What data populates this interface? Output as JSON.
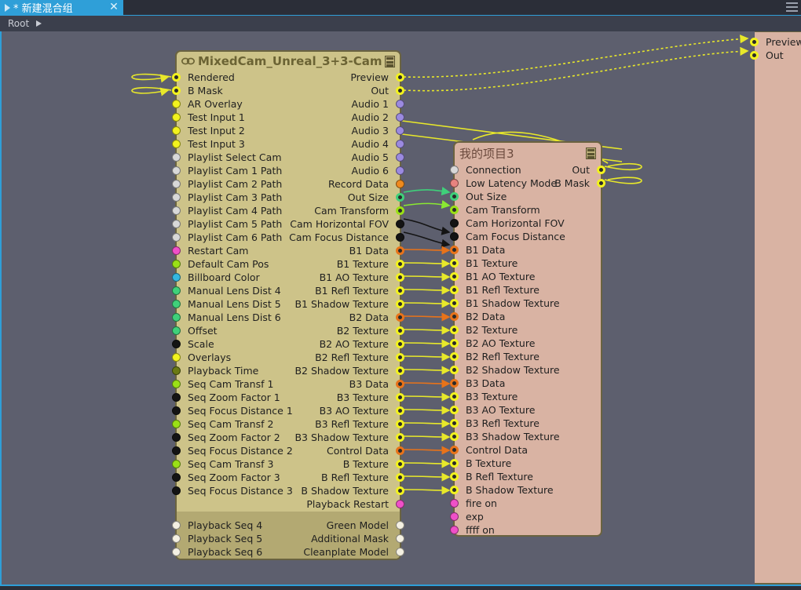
{
  "window": {
    "tab_label": "* 新建混合组",
    "tab_close": "✕",
    "breadcrumb": "Root",
    "menu_icon": "hamburger-icon"
  },
  "colors": {
    "canvas_bg": "#5d5f6e",
    "node_main_bg": "#cdc389",
    "node_sec_bg": "#d9b3a3",
    "accent": "#2f9fd8",
    "wire_yellow": "#e8e82a",
    "wire_green": "#3fd07a",
    "wire_lightgreen": "#8ae832",
    "wire_black": "#141414",
    "wire_orange": "#e8731a"
  },
  "main_node": {
    "title": "MixedCam_Unreal_3+3-Cam",
    "icon": "link-icon",
    "menu_icon": "burger-icon",
    "inputs": [
      {
        "label": "Rendered",
        "color": "#f2f21e",
        "ring": true
      },
      {
        "label": "B Mask",
        "color": "#f2f21e",
        "ring": true
      },
      {
        "label": "AR Overlay",
        "color": "#f2f21e",
        "ring": false
      },
      {
        "label": "Test Input 1",
        "color": "#f2f21e",
        "ring": false
      },
      {
        "label": "Test Input 2",
        "color": "#f2f21e",
        "ring": false
      },
      {
        "label": "Test Input 3",
        "color": "#f2f21e",
        "ring": false
      },
      {
        "label": "Playlist Select Cam",
        "color": "#d8d8d8",
        "ring": false
      },
      {
        "label": "Playlist Cam 1 Path",
        "color": "#d8d8d8",
        "ring": false
      },
      {
        "label": "Playlist Cam 2 Path",
        "color": "#d8d8d8",
        "ring": false
      },
      {
        "label": "Playlist Cam 3 Path",
        "color": "#d8d8d8",
        "ring": false
      },
      {
        "label": "Playlist Cam 4 Path",
        "color": "#d8d8d8",
        "ring": false
      },
      {
        "label": "Playlist Cam 5 Path",
        "color": "#d8d8d8",
        "ring": false
      },
      {
        "label": "Playlist Cam 6 Path",
        "color": "#d8d8d8",
        "ring": false
      },
      {
        "label": "Restart Cam",
        "color": "#f050c8",
        "ring": false
      },
      {
        "label": "Default Cam Pos",
        "color": "#9ae016",
        "ring": false
      },
      {
        "label": "Billboard Color",
        "color": "#35b8e0",
        "ring": false
      },
      {
        "label": "Manual Lens Dist 4",
        "color": "#3fd07a",
        "ring": false
      },
      {
        "label": "Manual Lens Dist 5",
        "color": "#3fd07a",
        "ring": false
      },
      {
        "label": "Manual Lens Dist 6",
        "color": "#3fd07a",
        "ring": false
      },
      {
        "label": "Offset",
        "color": "#3fd07a",
        "ring": false
      },
      {
        "label": "Scale",
        "color": "#141414",
        "ring": false
      },
      {
        "label": "Overlays",
        "color": "#f2f21e",
        "ring": false
      },
      {
        "label": "Playback Time",
        "color": "#6b7a14",
        "ring": false
      },
      {
        "label": "Seq Cam Transf 1",
        "color": "#9ae016",
        "ring": false
      },
      {
        "label": "Seq Zoom Factor 1",
        "color": "#141414",
        "ring": false
      },
      {
        "label": "Seq Focus Distance 1",
        "color": "#141414",
        "ring": false
      },
      {
        "label": "Seq Cam Transf 2",
        "color": "#9ae016",
        "ring": false
      },
      {
        "label": "Seq Zoom Factor 2",
        "color": "#141414",
        "ring": false
      },
      {
        "label": "Seq Focus Distance 2",
        "color": "#141414",
        "ring": false
      },
      {
        "label": "Seq Cam Transf 3",
        "color": "#9ae016",
        "ring": false
      },
      {
        "label": "Seq Zoom Factor 3",
        "color": "#141414",
        "ring": false
      },
      {
        "label": "Seq Focus Distance 3",
        "color": "#141414",
        "ring": false
      }
    ],
    "inputs_footer": [
      {
        "label": "Playback Seq 4",
        "color": "#f4f0e2",
        "ring": false
      },
      {
        "label": "Playback Seq 5",
        "color": "#f4f0e2",
        "ring": false
      },
      {
        "label": "Playback Seq 6",
        "color": "#f4f0e2",
        "ring": false
      }
    ],
    "outputs": [
      {
        "label": "Preview",
        "color": "#f2f21e",
        "ring": true
      },
      {
        "label": "Out",
        "color": "#f2f21e",
        "ring": true
      },
      {
        "label": "Audio 1",
        "color": "#9b8ae0",
        "ring": false
      },
      {
        "label": "Audio 2",
        "color": "#9b8ae0",
        "ring": false
      },
      {
        "label": "Audio 3",
        "color": "#9b8ae0",
        "ring": false
      },
      {
        "label": "Audio 4",
        "color": "#9b8ae0",
        "ring": false
      },
      {
        "label": "Audio 5",
        "color": "#9b8ae0",
        "ring": false
      },
      {
        "label": "Audio 6",
        "color": "#9b8ae0",
        "ring": false
      },
      {
        "label": "Record Data",
        "color": "#f08a1e",
        "ring": false
      },
      {
        "label": "Out Size",
        "color": "#3fd07a",
        "ring": true
      },
      {
        "label": "Cam Transform",
        "color": "#9ae016",
        "ring": true
      },
      {
        "label": "Cam Horizontal FOV",
        "color": "#141414",
        "ring": false
      },
      {
        "label": "Cam Focus Distance",
        "color": "#141414",
        "ring": false
      },
      {
        "label": "B1 Data",
        "color": "#e8731a",
        "ring": true
      },
      {
        "label": "B1 Texture",
        "color": "#f2f21e",
        "ring": true
      },
      {
        "label": "B1 AO Texture",
        "color": "#f2f21e",
        "ring": true
      },
      {
        "label": "B1 Refl Texture",
        "color": "#f2f21e",
        "ring": true
      },
      {
        "label": "B1 Shadow Texture",
        "color": "#f2f21e",
        "ring": true
      },
      {
        "label": "B2 Data",
        "color": "#e8731a",
        "ring": true
      },
      {
        "label": "B2 Texture",
        "color": "#f2f21e",
        "ring": true
      },
      {
        "label": "B2 AO Texture",
        "color": "#f2f21e",
        "ring": true
      },
      {
        "label": "B2 Refl Texture",
        "color": "#f2f21e",
        "ring": true
      },
      {
        "label": "B2 Shadow Texture",
        "color": "#f2f21e",
        "ring": true
      },
      {
        "label": "B3 Data",
        "color": "#e8731a",
        "ring": true
      },
      {
        "label": "B3 Texture",
        "color": "#f2f21e",
        "ring": true
      },
      {
        "label": "B3 AO Texture",
        "color": "#f2f21e",
        "ring": true
      },
      {
        "label": "B3 Refl Texture",
        "color": "#f2f21e",
        "ring": true
      },
      {
        "label": "B3 Shadow Texture",
        "color": "#f2f21e",
        "ring": true
      },
      {
        "label": "Control Data",
        "color": "#e8731a",
        "ring": true
      },
      {
        "label": "B Texture",
        "color": "#f2f21e",
        "ring": true
      },
      {
        "label": "B Refl Texture",
        "color": "#f2f21e",
        "ring": true
      },
      {
        "label": "B Shadow Texture",
        "color": "#f2f21e",
        "ring": true
      },
      {
        "label": "Playback Restart",
        "color": "#f050c8",
        "ring": false
      }
    ],
    "outputs_footer": [
      {
        "label": "Green Model",
        "color": "#f4f0e2",
        "ring": false
      },
      {
        "label": "Additional Mask",
        "color": "#f4f0e2",
        "ring": false
      },
      {
        "label": "Cleanplate Model",
        "color": "#f4f0e2",
        "ring": false
      }
    ]
  },
  "second_node": {
    "title": "我的项目3",
    "menu_icon": "burger-icon",
    "inputs": [
      {
        "label": "Connection",
        "color": "#d8d8d8",
        "ring": false
      },
      {
        "label": "Low Latency Mode",
        "color": "#e8837f",
        "ring": false
      },
      {
        "label": "Out Size",
        "color": "#3fd07a",
        "ring": true
      },
      {
        "label": "Cam Transform",
        "color": "#9ae016",
        "ring": true
      },
      {
        "label": "Cam Horizontal FOV",
        "color": "#141414",
        "ring": false
      },
      {
        "label": "Cam Focus Distance",
        "color": "#141414",
        "ring": false
      },
      {
        "label": "B1 Data",
        "color": "#e8731a",
        "ring": true
      },
      {
        "label": "B1 Texture",
        "color": "#f2f21e",
        "ring": true
      },
      {
        "label": "B1 AO Texture",
        "color": "#f2f21e",
        "ring": true
      },
      {
        "label": "B1 Refl Texture",
        "color": "#f2f21e",
        "ring": true
      },
      {
        "label": "B1 Shadow Texture",
        "color": "#f2f21e",
        "ring": true
      },
      {
        "label": "B2 Data",
        "color": "#e8731a",
        "ring": true
      },
      {
        "label": "B2 Texture",
        "color": "#f2f21e",
        "ring": true
      },
      {
        "label": "B2 AO Texture",
        "color": "#f2f21e",
        "ring": true
      },
      {
        "label": "B2 Refl Texture",
        "color": "#f2f21e",
        "ring": true
      },
      {
        "label": "B2 Shadow Texture",
        "color": "#f2f21e",
        "ring": true
      },
      {
        "label": "B3 Data",
        "color": "#e8731a",
        "ring": true
      },
      {
        "label": "B3 Texture",
        "color": "#f2f21e",
        "ring": true
      },
      {
        "label": "B3 AO Texture",
        "color": "#f2f21e",
        "ring": true
      },
      {
        "label": "B3 Refl Texture",
        "color": "#f2f21e",
        "ring": true
      },
      {
        "label": "B3 Shadow Texture",
        "color": "#f2f21e",
        "ring": true
      },
      {
        "label": "Control Data",
        "color": "#e8731a",
        "ring": true
      },
      {
        "label": "B Texture",
        "color": "#f2f21e",
        "ring": true
      },
      {
        "label": "B Refl Texture",
        "color": "#f2f21e",
        "ring": true
      },
      {
        "label": "B Shadow Texture",
        "color": "#f2f21e",
        "ring": true
      },
      {
        "label": "fire  on",
        "color": "#f050c8",
        "ring": false
      },
      {
        "label": "exp",
        "color": "#f050c8",
        "ring": false
      },
      {
        "label": "ffff on",
        "color": "#f050c8",
        "ring": false
      }
    ],
    "outputs": [
      {
        "label": "Out",
        "color": "#f2f21e",
        "ring": true
      },
      {
        "label": "B Mask",
        "color": "#f2f21e",
        "ring": true
      }
    ]
  },
  "edge_node": {
    "outputs": [
      {
        "label": "Preview",
        "color": "#f2f21e",
        "ring": true
      },
      {
        "label": "Out",
        "color": "#f2f21e",
        "ring": true
      }
    ]
  }
}
